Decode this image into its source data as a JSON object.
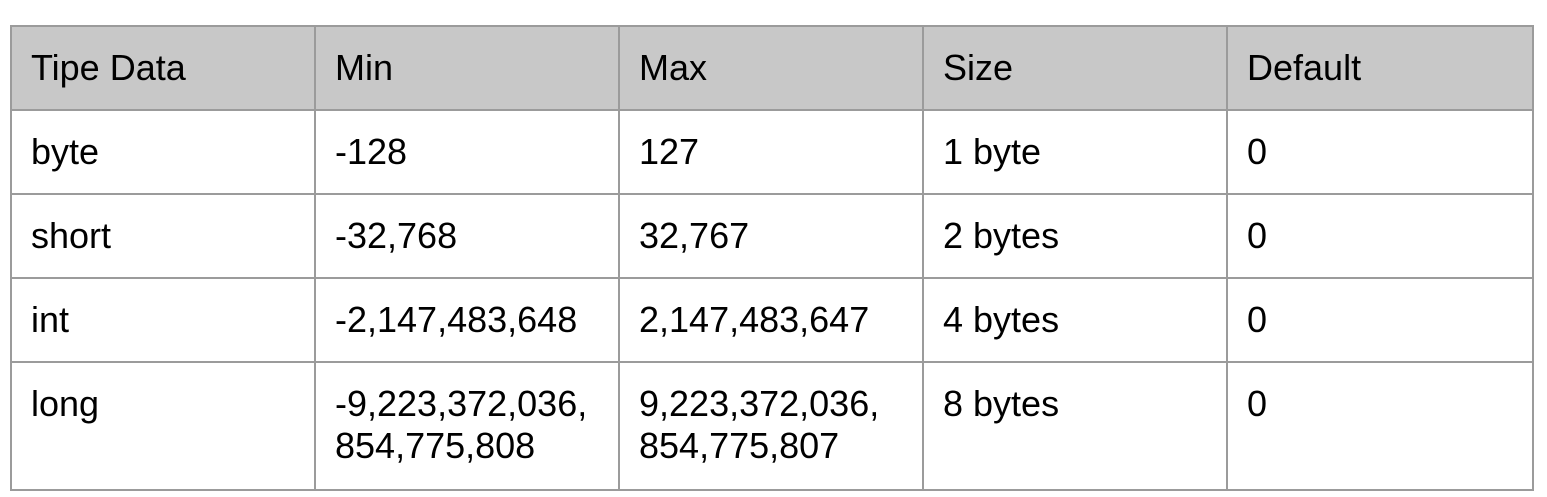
{
  "table": {
    "headers": [
      "Tipe Data",
      "Min",
      "Max",
      "Size",
      "Default"
    ],
    "rows": [
      {
        "type": "byte",
        "min": [
          "-128"
        ],
        "max": [
          "127"
        ],
        "size": "1 byte",
        "default": "0"
      },
      {
        "type": "short",
        "min": [
          "-32,768"
        ],
        "max": [
          "32,767"
        ],
        "size": "2 bytes",
        "default": "0"
      },
      {
        "type": "int",
        "min": [
          "-2,147,483,648"
        ],
        "max": [
          "2,147,483,647"
        ],
        "size": "4 bytes",
        "default": "0"
      },
      {
        "type": "long",
        "min": [
          "-9,223,372,036,",
          "854,775,808"
        ],
        "max": [
          "9,223,372,036,",
          "854,775,807"
        ],
        "size": "8 bytes",
        "default": "0"
      }
    ]
  }
}
